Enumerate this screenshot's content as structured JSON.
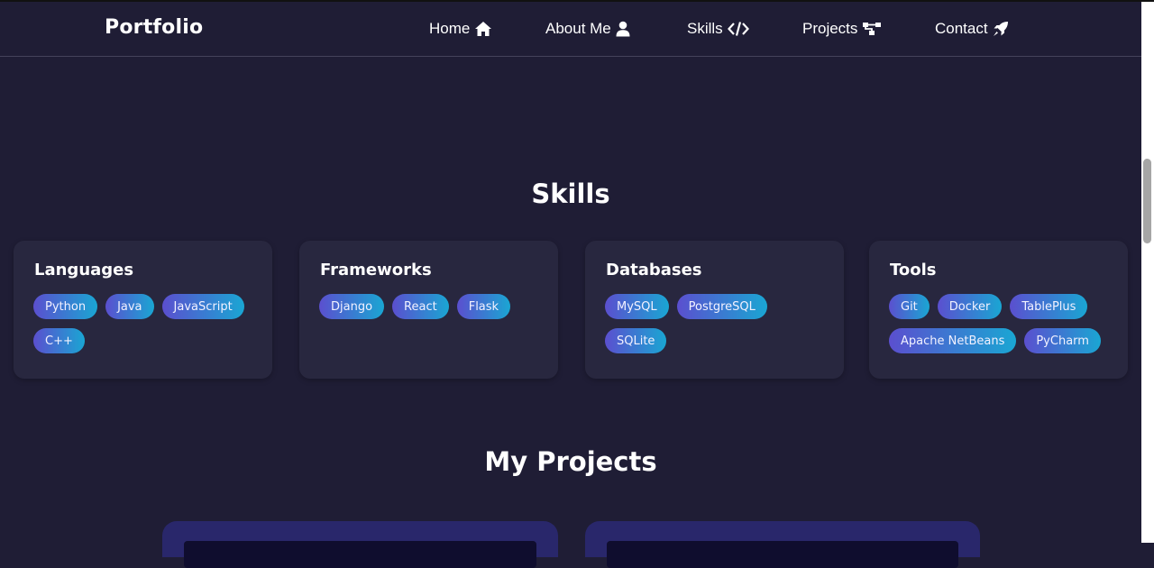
{
  "header": {
    "brand": "Portfolio",
    "nav": [
      {
        "label": "Home",
        "icon": "home-icon"
      },
      {
        "label": "About Me",
        "icon": "user-icon"
      },
      {
        "label": "Skills",
        "icon": "code-icon"
      },
      {
        "label": "Projects",
        "icon": "sitemap-icon"
      },
      {
        "label": "Contact",
        "icon": "rocket-icon"
      }
    ]
  },
  "skills": {
    "title": "Skills",
    "categories": [
      {
        "title": "Languages",
        "items": [
          "Python",
          "Java",
          "JavaScript",
          "C++"
        ]
      },
      {
        "title": "Frameworks",
        "items": [
          "Django",
          "React",
          "Flask"
        ]
      },
      {
        "title": "Databases",
        "items": [
          "MySQL",
          "PostgreSQL",
          "SQLite"
        ]
      },
      {
        "title": "Tools",
        "items": [
          "Git",
          "Docker",
          "TablePlus",
          "Apache NetBeans",
          "PyCharm"
        ]
      }
    ]
  },
  "projects": {
    "title": "My Projects"
  },
  "colors": {
    "background": "#1f1d35",
    "card": "#28273f",
    "tag_gradient_start": "#5b4fcf",
    "tag_gradient_end": "#1aa6d3"
  }
}
